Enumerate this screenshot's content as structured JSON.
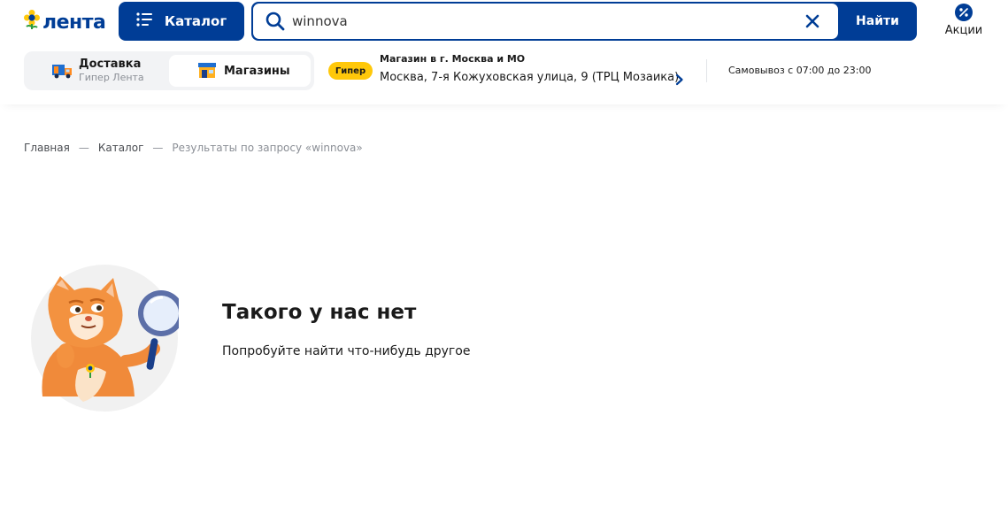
{
  "header": {
    "logo_text": "лента",
    "catalog_label": "Каталог",
    "search": {
      "value": "winnova",
      "placeholder": "",
      "button_label": "Найти"
    },
    "promo_label": "Акции"
  },
  "delivery_mode": {
    "items": [
      {
        "title": "Доставка",
        "subtitle": "Гипер Лента"
      },
      {
        "title": "Магазины",
        "subtitle": ""
      }
    ]
  },
  "store": {
    "badge": "Гипер",
    "label": "Магазин в г. Москва и МО",
    "address": "Москва, 7-я Кожуховская улица, 9 (ТРЦ Мозаика)",
    "pickup": "Самовывоз с 07:00 до 23:00"
  },
  "breadcrumb": {
    "home": "Главная",
    "separator": "—",
    "catalog": "Каталог",
    "current": "Результаты по запросу «winnova»"
  },
  "empty_state": {
    "title": "Такого у нас нет",
    "subtitle": "Попробуйте найти что-нибудь другое"
  },
  "colors": {
    "brand": "#003d96",
    "accent": "#ffc80a",
    "background": "#ffffff",
    "muted": "#8b8f96"
  },
  "icons": [
    "sunflower-logo-icon",
    "list-icon",
    "search-icon",
    "close-icon",
    "percent-icon",
    "truck-icon",
    "store-icon",
    "chevron-right-icon",
    "cat-magnifier-illustration"
  ]
}
